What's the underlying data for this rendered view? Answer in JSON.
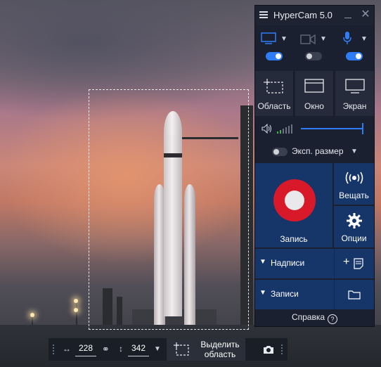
{
  "app": {
    "title": "HyperCam 5.0"
  },
  "sources": {
    "screen": {
      "enabled": true
    },
    "webcam": {
      "enabled": false
    },
    "microphone": {
      "enabled": true
    }
  },
  "modes": [
    {
      "label": "Область",
      "icon": "region-icon"
    },
    {
      "label": "Окно",
      "icon": "window-icon"
    },
    {
      "label": "Экран",
      "icon": "monitor-icon"
    }
  ],
  "volume": {
    "level_percent": 100
  },
  "expanded_size": {
    "label": "Эксп. размер",
    "enabled": false
  },
  "record": {
    "label": "Запись"
  },
  "broadcast": {
    "label": "Вещать"
  },
  "options": {
    "label": "Опции"
  },
  "captions": {
    "label": "Надписи"
  },
  "recordings": {
    "label": "Записи"
  },
  "help": {
    "label": "Справка",
    "icon_glyph": "?"
  },
  "toolbar": {
    "width": "228",
    "height": "342",
    "select_area_line1": "Выделить",
    "select_area_line2": "область"
  },
  "colors": {
    "accent": "#2f7df6",
    "record": "#d8192a",
    "panel": "#1a2030",
    "button": "#16366a"
  }
}
